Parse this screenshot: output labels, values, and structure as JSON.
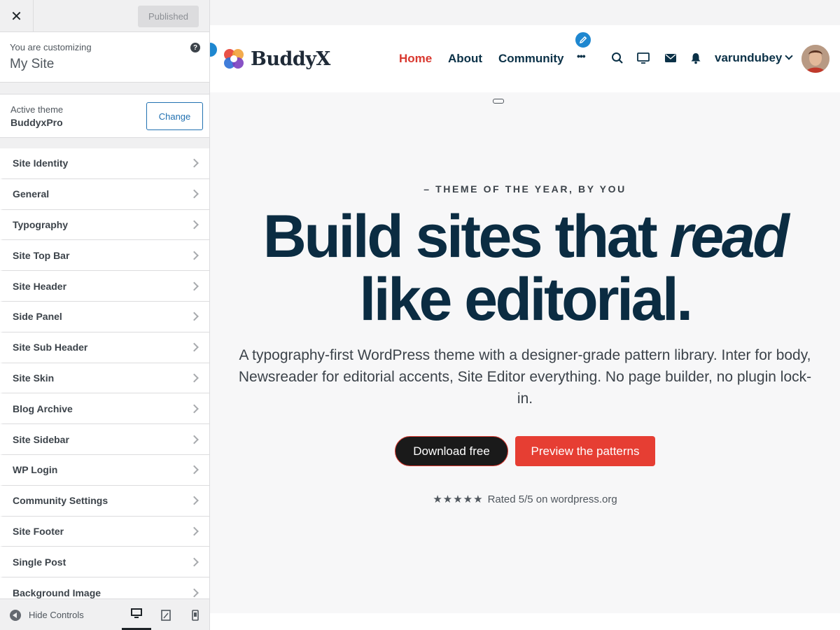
{
  "customizer": {
    "close_symbol": "✕",
    "publish_label": "Published",
    "customizing_label": "You are customizing",
    "site_name": "My Site",
    "help_symbol": "?",
    "active_theme_label": "Active theme",
    "active_theme_name": "BuddyxPro",
    "change_label": "Change",
    "sections": [
      {
        "label": "Site Identity"
      },
      {
        "label": "General"
      },
      {
        "label": "Typography"
      },
      {
        "label": "Site Top Bar"
      },
      {
        "label": "Site Header"
      },
      {
        "label": "Side Panel"
      },
      {
        "label": "Site Sub Header"
      },
      {
        "label": "Site Skin"
      },
      {
        "label": "Blog Archive"
      },
      {
        "label": "Site Sidebar"
      },
      {
        "label": "WP Login"
      },
      {
        "label": "Community Settings"
      },
      {
        "label": "Site Footer"
      },
      {
        "label": "Single Post"
      },
      {
        "label": "Background Image"
      }
    ],
    "hide_controls_label": "Hide Controls",
    "devices": [
      "desktop-icon",
      "tablet-icon",
      "mobile-icon"
    ],
    "active_device": "desktop"
  },
  "site": {
    "logo_text": "BuddyX",
    "nav": [
      {
        "label": "Home",
        "active": true
      },
      {
        "label": "About",
        "active": false
      },
      {
        "label": "Community",
        "active": false
      }
    ],
    "more_symbol": "•••",
    "header_icons": [
      "search-icon",
      "monitor-icon",
      "mail-icon",
      "bell-icon"
    ],
    "username": "varundubey",
    "hero": {
      "eyebrow": "– THEME OF THE YEAR, BY YOU",
      "headline_1": "Build sites that ",
      "headline_em": "read",
      "headline_2": "like editorial.",
      "lead": "A typography-first WordPress theme with a designer-grade pattern library. Inter for body, Newsreader for editorial accents, Site Editor everything. No page builder, no plugin lock-in.",
      "primary_cta": "Download free",
      "secondary_cta": "Preview the patterns",
      "stars": "★★★★★",
      "rating_text": "Rated 5/5 on wordpress.org"
    },
    "colors": {
      "accent_red": "#e63e33",
      "nav_active": "#d9382f",
      "heading_navy": "#0b2c42",
      "edit_blue": "#1e87d0"
    }
  }
}
